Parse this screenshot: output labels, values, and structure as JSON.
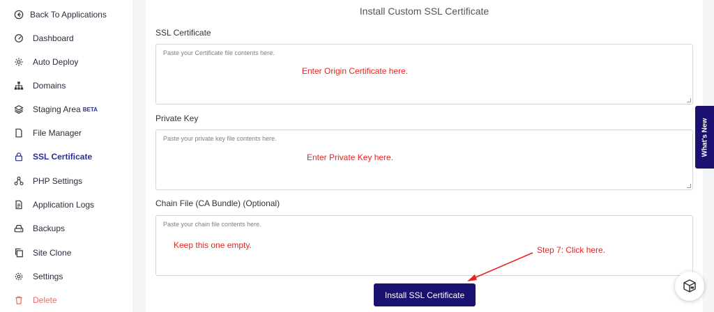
{
  "sidebar": {
    "back": {
      "label": "Back To Applications",
      "icon": "arrow-left-circle-icon"
    },
    "items": [
      {
        "label": "Dashboard",
        "icon": "gauge-icon"
      },
      {
        "label": "Auto Deploy",
        "icon": "gear-sync-icon"
      },
      {
        "label": "Domains",
        "icon": "sitemap-icon"
      },
      {
        "label": "Staging Area",
        "icon": "layers-icon",
        "badge": "BETA"
      },
      {
        "label": "File Manager",
        "icon": "file-icon"
      },
      {
        "label": "SSL Certificate",
        "icon": "lock-icon",
        "active": true
      },
      {
        "label": "PHP Settings",
        "icon": "nodes-icon"
      },
      {
        "label": "Application Logs",
        "icon": "document-icon"
      },
      {
        "label": "Backups",
        "icon": "drive-icon"
      },
      {
        "label": "Site Clone",
        "icon": "copy-icon"
      },
      {
        "label": "Settings",
        "icon": "gear-icon"
      },
      {
        "label": "Delete",
        "icon": "trash-icon",
        "danger": true
      }
    ]
  },
  "main": {
    "title": "Install Custom SSL Certificate",
    "fields": [
      {
        "label": "SSL Certificate",
        "placeholder": "Paste your Certificate file contents here.",
        "annotation": "Enter Origin Certificate here."
      },
      {
        "label": "Private Key",
        "placeholder": "Paste your private key file contents here.",
        "annotation": "Enter Private Key here."
      },
      {
        "label": "Chain File (CA Bundle) (Optional)",
        "placeholder": "Paste your chain file contents here.",
        "annotation": "Keep this one empty."
      }
    ],
    "install_button": "Install SSL Certificate",
    "step_annotation": "Step 7: Click here."
  },
  "whats_new": "What's New",
  "colors": {
    "accent": "#1a1170",
    "active_nav": "#2b2b9b",
    "danger": "#f06a6a",
    "annotation": "#e8221f"
  }
}
